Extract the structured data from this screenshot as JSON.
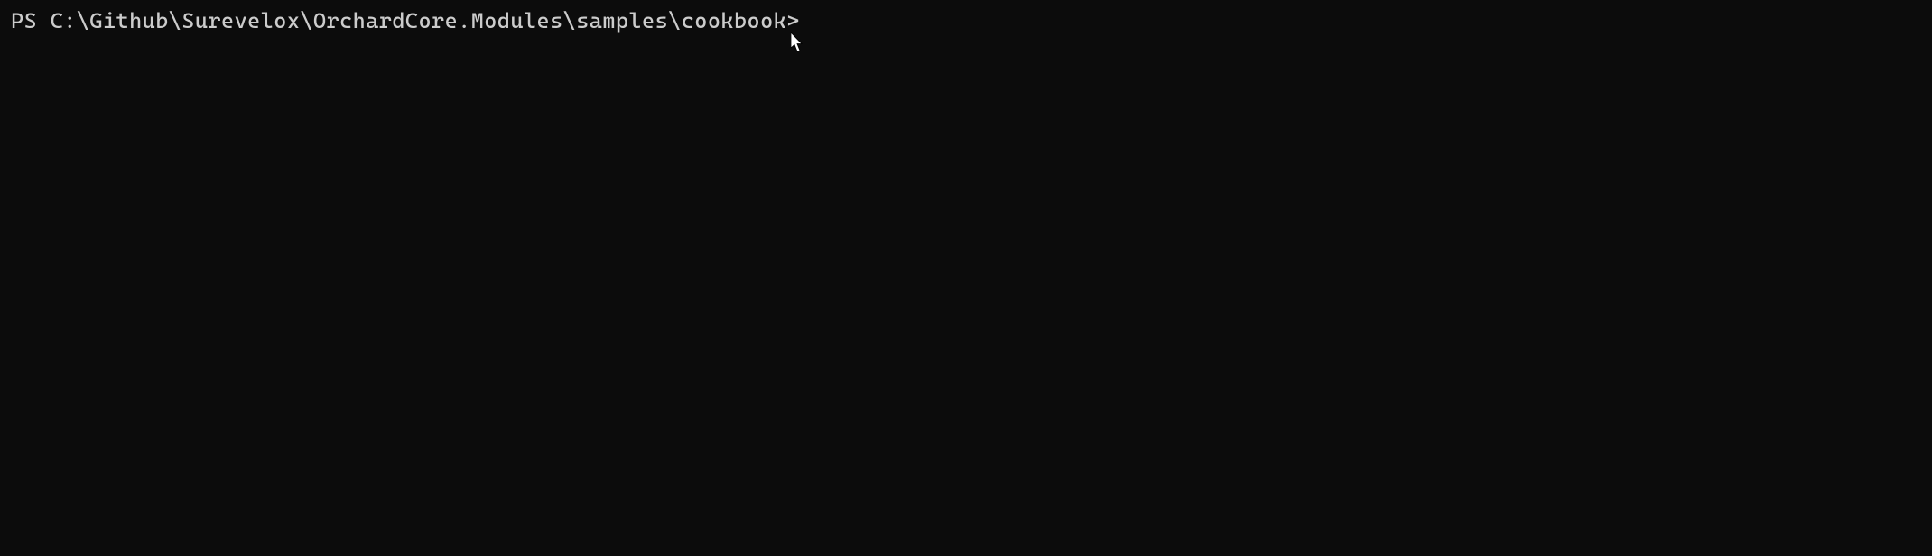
{
  "terminal": {
    "prompt_prefix": "PS ",
    "prompt_path": "C:\\Github\\Surevelox\\OrchardCore.Modules\\samples\\cookbook",
    "prompt_suffix": "> ",
    "command_value": ""
  }
}
